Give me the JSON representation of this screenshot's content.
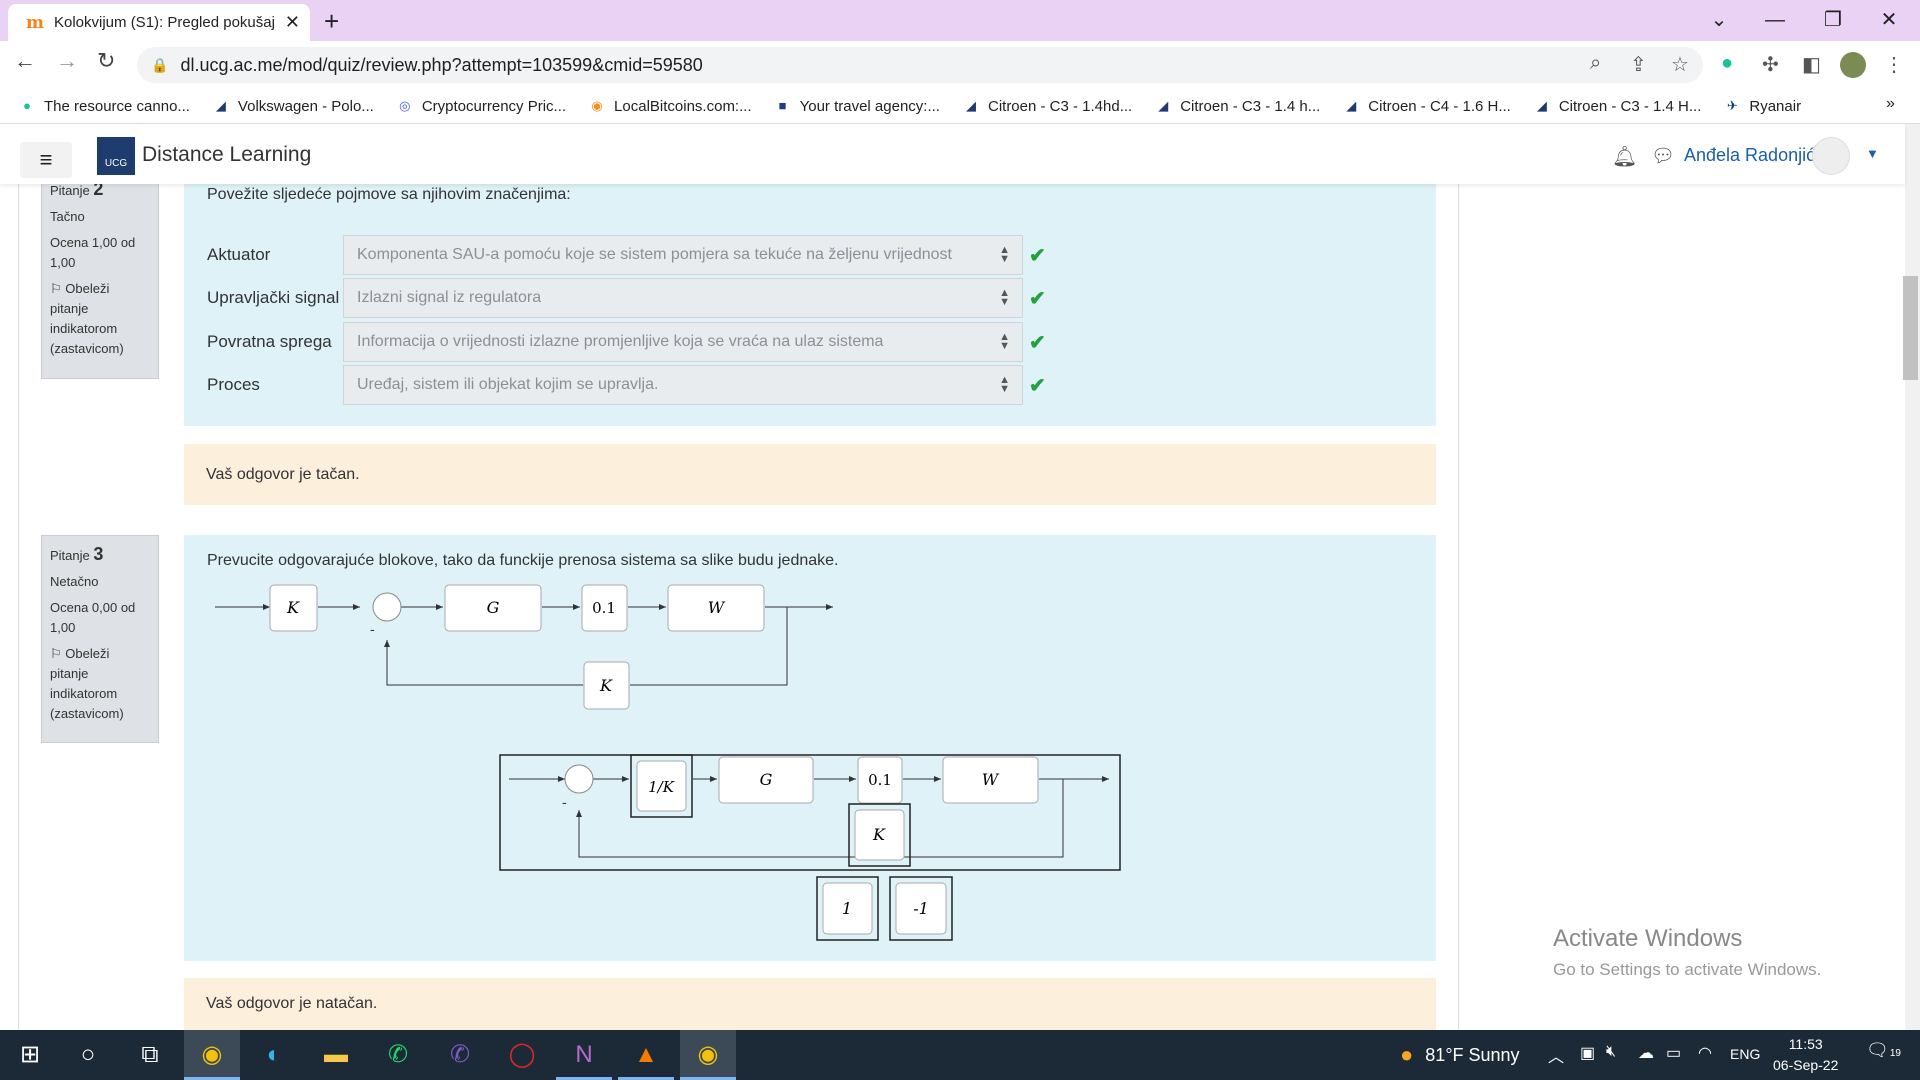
{
  "browser": {
    "tab_title": "Kolokvijum (S1): Pregled pokušaj",
    "tab_favicon": "m",
    "url": "dl.ucg.ac.me/mod/quiz/review.php?attempt=103599&cmid=59580",
    "bookmarks": [
      {
        "label": "The resource canno...",
        "icon": "grammarly-icon",
        "color": "#15c39a"
      },
      {
        "label": "Volkswagen - Polo...",
        "icon": "car-icon",
        "color": "#1e3a6e"
      },
      {
        "label": "Cryptocurrency Pric...",
        "icon": "coin-icon",
        "color": "#3d5afe"
      },
      {
        "label": "LocalBitcoins.com:...",
        "icon": "bitcoin-icon",
        "color": "#f7931a"
      },
      {
        "label": "Your travel agency:...",
        "icon": "travel-icon",
        "color": "#1e3a8a"
      },
      {
        "label": "Citroen - C3 - 1.4hd...",
        "icon": "car-icon",
        "color": "#1e3a6e"
      },
      {
        "label": "Citroen - C3 - 1.4 h...",
        "icon": "car-icon",
        "color": "#1e3a6e"
      },
      {
        "label": "Citroen - C4 - 1.6 H...",
        "icon": "car-icon",
        "color": "#1e3a6e"
      },
      {
        "label": "Citroen - C3 - 1.4 H...",
        "icon": "car-icon",
        "color": "#1e3a6e"
      },
      {
        "label": "Ryanair",
        "icon": "ryanair-icon",
        "color": "#073590"
      }
    ]
  },
  "navbar": {
    "site_name": "Distance Learning",
    "logo_text": "UCG",
    "user_name": "Anđela Radonjić"
  },
  "question2": {
    "number_label": "Pitanje",
    "number": "2",
    "status": "Tačno",
    "grade": "Ocena 1,00 od 1,00",
    "flag": "Obeleži pitanje indikatorom (zastavicom)",
    "text": "Povežite sljedeće pojmove sa njihovim značenjima:",
    "rows": [
      {
        "label": "Aktuator",
        "answer": "Komponenta SAU-a pomoću koje se sistem pomjera sa tekuće na željenu vrijednost"
      },
      {
        "label": "Upravljački signal",
        "answer": "Izlazni signal iz regulatora"
      },
      {
        "label": "Povratna sprega",
        "answer": "Informacija o vrijednosti izlazne promjenljive koja se vraća na ulaz sistema"
      },
      {
        "label": "Proces",
        "answer": "Uređaj, sistem ili objekat kojim se upravlja."
      }
    ],
    "feedback": "Vaš odgovor je tačan."
  },
  "question3": {
    "number_label": "Pitanje",
    "number": "3",
    "status": "Netačno",
    "grade": "Ocena 0,00 od 1,00",
    "flag": "Obeleži pitanje indikatorom (zastavicom)",
    "text": "Prevucite odgovarajuće blokove, tako da funckije prenosa sistema sa slike budu jednake.",
    "diagram1": {
      "blocks": [
        "K",
        "G",
        "0.1",
        "W",
        "K"
      ],
      "minus": "-"
    },
    "diagram2": {
      "blocks": [
        "1/K",
        "G",
        "0.1",
        "W",
        "K"
      ],
      "minus": "-"
    },
    "drag_options": [
      "1",
      "-1"
    ],
    "feedback": "Vaš odgovor je natačan."
  },
  "watermark": {
    "line1": "Activate Windows",
    "line2": "Go to Settings to activate Windows."
  },
  "taskbar": {
    "weather": "81°F  Sunny",
    "lang": "ENG",
    "time": "11:53",
    "date": "06-Sep-22",
    "notifications": "19"
  }
}
